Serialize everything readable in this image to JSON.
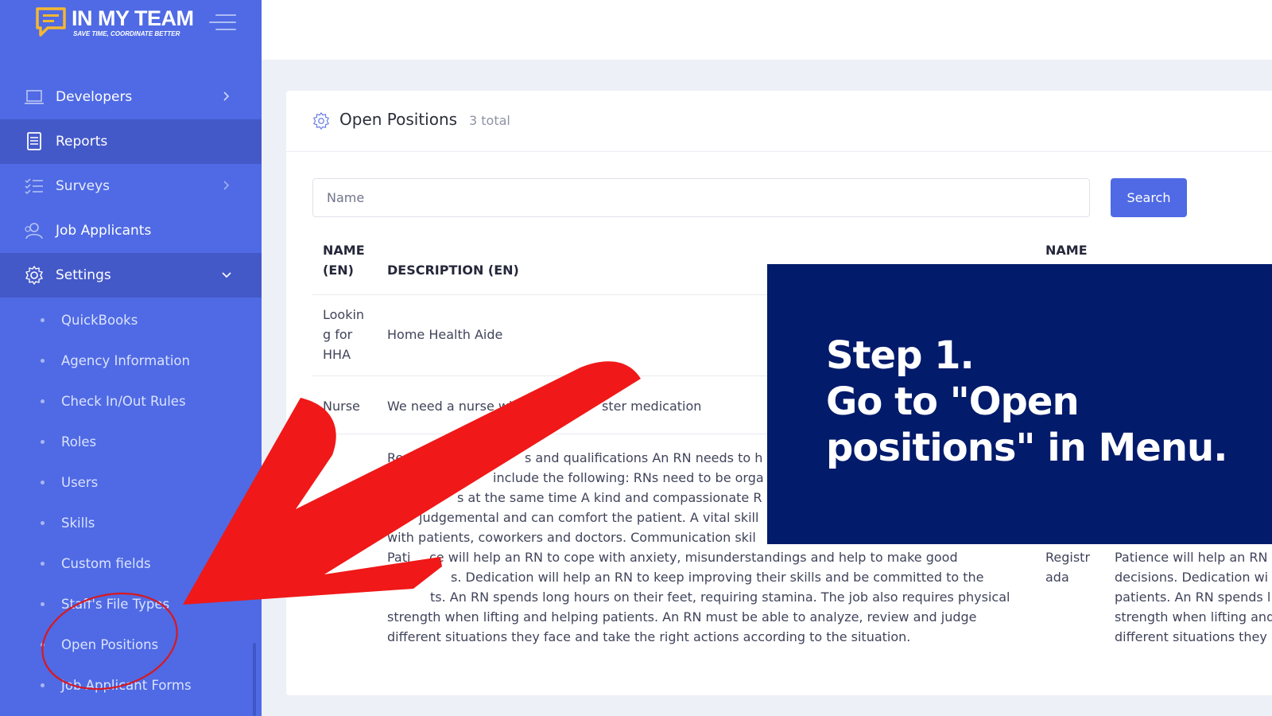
{
  "brand": {
    "name": "IN MY TEAM",
    "tagline": "SAVE TIME, COORDINATE BETTER"
  },
  "sidebar": {
    "items": [
      {
        "label": "Developers",
        "icon": "laptop-icon",
        "chevron": "right"
      },
      {
        "label": "Reports",
        "icon": "document-icon",
        "active": true
      },
      {
        "label": "Surveys",
        "icon": "checklist-icon",
        "chevron": "right"
      },
      {
        "label": "Job Applicants",
        "icon": "users-icon"
      },
      {
        "label": "Settings",
        "icon": "gear-icon",
        "chevron": "down"
      }
    ],
    "sub_items": [
      "QuickBooks",
      "Agency Information",
      "Check In/Out Rules",
      "Roles",
      "Users",
      "Skills",
      "Custom fields",
      "Staff's File Types",
      "Open Positions",
      "Job Applicant Forms"
    ]
  },
  "card": {
    "title": "Open Positions",
    "count": "3 total"
  },
  "search": {
    "placeholder": "Name",
    "button": "Search"
  },
  "table": {
    "headers": {
      "name_en_1": "NAME",
      "name_en_2": "(EN)",
      "description_en": "DESCRIPTION (EN)",
      "name_2": "NAME"
    },
    "rows": [
      {
        "name": [
          "Lookin",
          "g for",
          "HHA"
        ],
        "description": [
          "Home Health Aide"
        ]
      },
      {
        "name": [
          "Nurse"
        ],
        "description": [
          "We need a nurse wh",
          "ster medication"
        ]
      },
      {
        "name": [],
        "description": [
          "Regist",
          "s and qualifications An RN needs to h",
          "N",
          "include the following: RNs need to be orga",
          "s at the same time A kind and compassionate R",
          "judgemental and can comfort the patient. A vital skill",
          "with patients, coworkers and doctors. Communication skil",
          "Pati",
          "ce will help an RN to cope with anxiety, misunderstandings and help to make good",
          "s. Dedication will help an RN to keep improving their skills and be committed to the",
          "ts. An RN spends long hours on their feet, requiring stamina. The job also requires physical",
          "strength when lifting and helping patients. An RN must be able to analyze, review and judge",
          "different situations they face and take the right actions according to the situation."
        ],
        "name_2": [
          "Registr",
          "ada"
        ],
        "description_2": [
          "Patience will help an RN",
          "decisions. Dedication wi",
          "patients. An RN spends l",
          "strength when lifting and",
          "different situations they"
        ]
      }
    ]
  },
  "overlay": {
    "line1": "Step 1.",
    "line2": "Go to \"Open",
    "line3": "positions\" in Menu."
  },
  "colors": {
    "sidebar": "#4f6ae4",
    "sidebar_active": "#4459c8",
    "overlay": "#021b6b",
    "arrow": "#f01818",
    "button": "#4f6ae4"
  }
}
